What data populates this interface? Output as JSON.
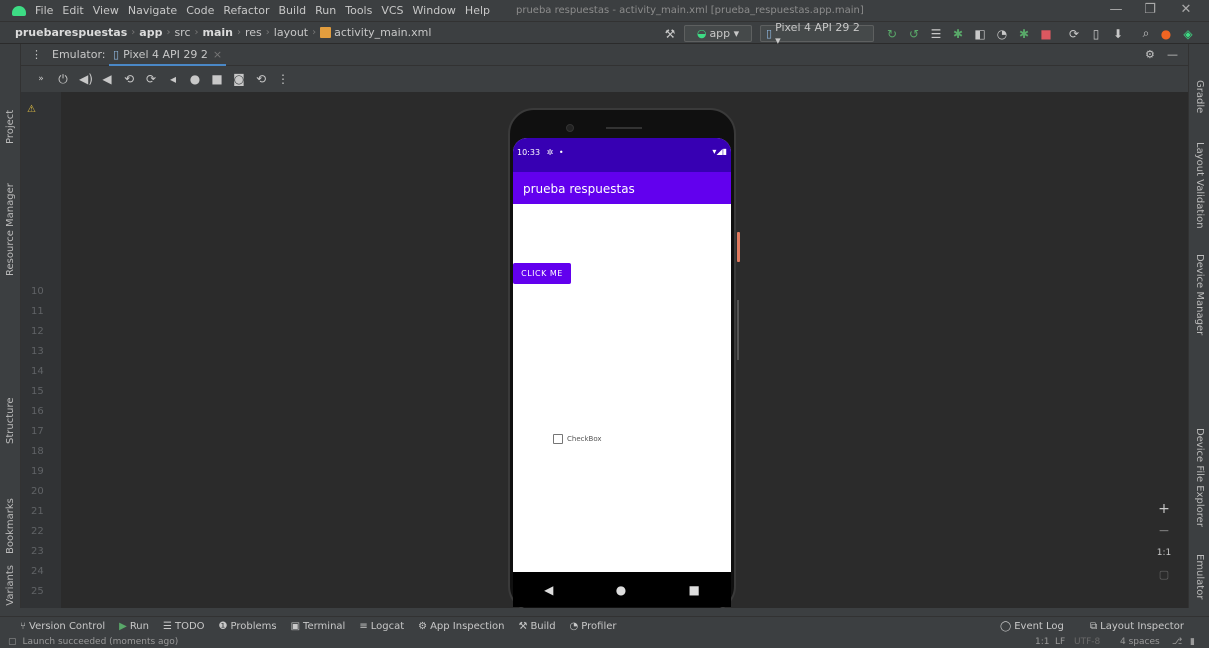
{
  "window": {
    "title": "prueba respuestas - activity_main.xml [prueba_respuestas.app.main]",
    "controls": {
      "minimize": "—",
      "restore": "❐",
      "close": "✕"
    }
  },
  "menu": [
    {
      "label": "File"
    },
    {
      "label": "Edit"
    },
    {
      "label": "View"
    },
    {
      "label": "Navigate"
    },
    {
      "label": "Code"
    },
    {
      "label": "Refactor"
    },
    {
      "label": "Build"
    },
    {
      "label": "Run"
    },
    {
      "label": "Tools"
    },
    {
      "label": "VCS"
    },
    {
      "label": "Window"
    },
    {
      "label": "Help"
    }
  ],
  "breadcrumb": [
    "pruebarespuestas",
    "app",
    "src",
    "main",
    "res",
    "layout",
    "activity_main.xml"
  ],
  "toolbar": {
    "run_config": "app ▾",
    "device": "Pixel 4 API 29 2 ▾"
  },
  "emulator": {
    "label": "Emulator:",
    "tab": "Pixel 4 API 29 2",
    "tab_close": "×"
  },
  "left_tools": [
    "Project",
    "Resource Manager",
    "Structure",
    "Bookmarks",
    "Build Variants"
  ],
  "right_tools": [
    "Gradle",
    "Layout Validation",
    "Device Manager",
    "Device File Explorer",
    "Emulator"
  ],
  "gutter_lines": [
    "10",
    "11",
    "12",
    "13",
    "14",
    "15",
    "16",
    "17",
    "18",
    "19",
    "20",
    "21",
    "22",
    "23",
    "24",
    "25"
  ],
  "phone": {
    "time": "10:33",
    "status_icons": "▾◢▮",
    "app_title": "prueba respuestas",
    "button_label": "CLICK ME",
    "checkbox_label": "CheckBox",
    "nav_back": "◀",
    "nav_home": "●",
    "nav_recent": "■"
  },
  "zoom": {
    "plus": "+",
    "minus": "−",
    "ratio": "1:1"
  },
  "bottom_tools": [
    {
      "icon": "⑂",
      "label": "Version Control"
    },
    {
      "icon": "▶",
      "label": "Run"
    },
    {
      "icon": "☰",
      "label": "TODO"
    },
    {
      "icon": "❶",
      "label": "Problems"
    },
    {
      "icon": "▣",
      "label": "Terminal"
    },
    {
      "icon": "≡",
      "label": "Logcat"
    },
    {
      "icon": "⚙",
      "label": "App Inspection"
    },
    {
      "icon": "⚒",
      "label": "Build"
    },
    {
      "icon": "◔",
      "label": "Profiler"
    }
  ],
  "bottom_right_tools": [
    {
      "icon": "◯",
      "label": "Event Log"
    },
    {
      "icon": "⧉",
      "label": "Layout Inspector"
    }
  ],
  "status": {
    "message": "Launch succeeded (moments ago)",
    "position": "1:1",
    "line_sep": "LF",
    "encoding": "UTF-8",
    "indent": "4 spaces"
  },
  "colors": {
    "primary": "#6200ee",
    "primary_dark": "#3700b3",
    "ide_bg": "#2b2b2b",
    "ide_panel": "#3c3f41"
  }
}
